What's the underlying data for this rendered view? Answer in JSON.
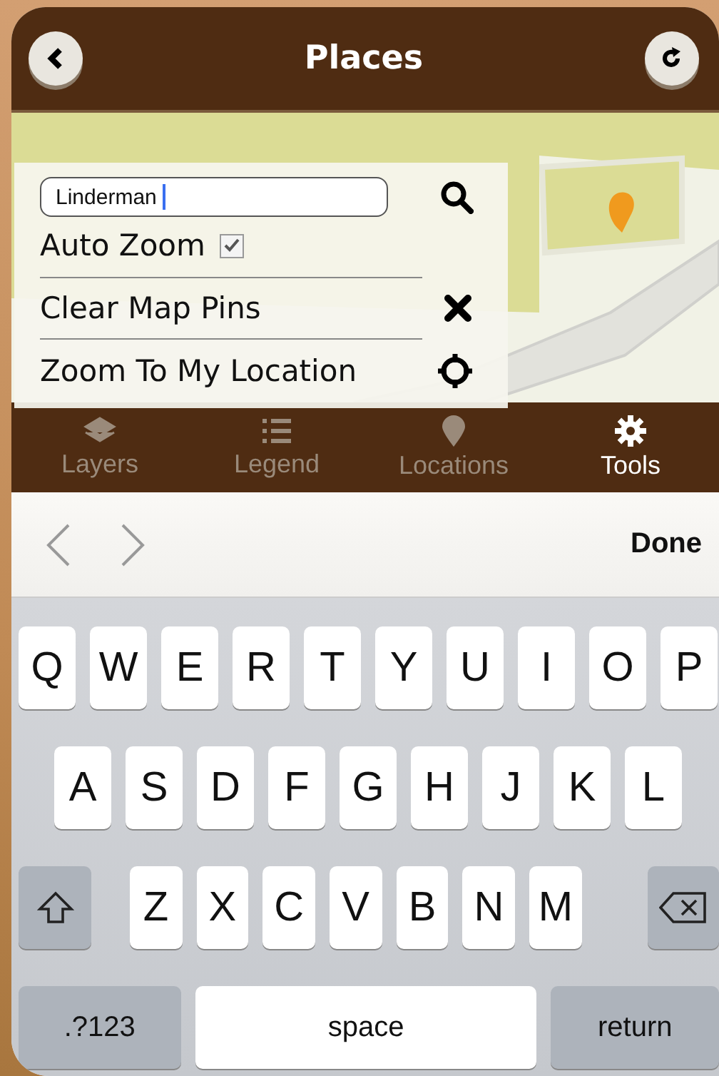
{
  "header": {
    "title": "Places"
  },
  "tools_panel": {
    "search": {
      "value": "Linderman"
    },
    "auto_zoom": {
      "label": "Auto Zoom",
      "checked": true
    },
    "items": [
      {
        "label": "Clear Map Pins",
        "kind": "clear"
      },
      {
        "label": "Zoom To My Location",
        "kind": "locate"
      }
    ]
  },
  "tabs": [
    {
      "label": "Layers",
      "kind": "layers",
      "selected": false
    },
    {
      "label": "Legend",
      "kind": "legend",
      "selected": false
    },
    {
      "label": "Locations",
      "kind": "locations",
      "selected": false
    },
    {
      "label": "Tools",
      "kind": "tools",
      "selected": true
    }
  ],
  "keyboard_toolbar": {
    "done": "Done"
  },
  "keyboard": {
    "rows": [
      [
        "Q",
        "W",
        "E",
        "R",
        "T",
        "Y",
        "U",
        "I",
        "O",
        "P"
      ],
      [
        "A",
        "S",
        "D",
        "F",
        "G",
        "H",
        "J",
        "K",
        "L"
      ],
      [
        "Z",
        "X",
        "C",
        "V",
        "B",
        "N",
        "M"
      ]
    ],
    "numbers_key": ".?123",
    "space_key": "space",
    "return_key": "return"
  }
}
